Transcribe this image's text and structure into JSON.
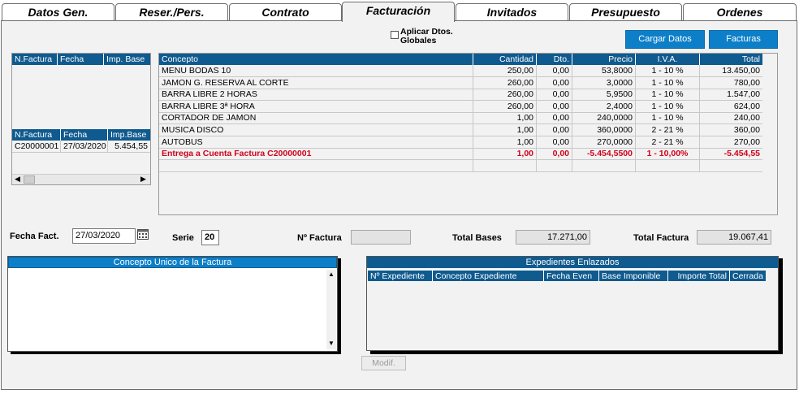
{
  "tabs": [
    "Datos Gen.",
    "Reser./Pers.",
    "Contrato",
    "Facturación",
    "Invitados",
    "Presupuesto",
    "Ordenes"
  ],
  "active_tab": "Facturación",
  "top": {
    "aplicar_label_1": "Aplicar Dtos.",
    "aplicar_label_2": "Globales",
    "cargar_datos": "Cargar Datos",
    "facturas": "Facturas"
  },
  "left_grid_1": {
    "headers": [
      "N.Factura",
      "Fecha",
      "Imp. Base"
    ]
  },
  "left_grid_2": {
    "headers": [
      "N.Factura",
      "Fecha",
      "Imp.Base"
    ],
    "rows": [
      [
        "C20000001",
        "27/03/2020",
        "5.454,55"
      ]
    ]
  },
  "lines": {
    "headers": [
      "Concepto",
      "Cantidad",
      "Dto.",
      "Precio",
      "I.V.A.",
      "Total"
    ],
    "rows": [
      [
        "MENU BODAS 10",
        "250,00",
        "0,00",
        "53,8000",
        "1 - 10 %",
        "13.450,00"
      ],
      [
        "JAMON G. RESERVA AL CORTE",
        "260,00",
        "0,00",
        "3,0000",
        "1 - 10 %",
        "780,00"
      ],
      [
        "BARRA LIBRE 2 HORAS",
        "260,00",
        "0,00",
        "5,9500",
        "1 - 10 %",
        "1.547,00"
      ],
      [
        "BARRA LIBRE 3ª HORA",
        "260,00",
        "0,00",
        "2,4000",
        "1 - 10 %",
        "624,00"
      ],
      [
        "CORTADOR DE JAMON",
        "1,00",
        "0,00",
        "240,0000",
        "1 - 10 %",
        "240,00"
      ],
      [
        "MUSICA DISCO",
        "1,00",
        "0,00",
        "360,0000",
        "2 - 21 %",
        "360,00"
      ],
      [
        "AUTOBUS",
        "1,00",
        "0,00",
        "270,0000",
        "2 - 21 %",
        "270,00"
      ]
    ],
    "highlight_row": [
      "Entrega a Cuenta Factura C20000001",
      "1,00",
      "0,00",
      "-5.454,5500",
      "1 - 10,00%",
      "-5.454,55"
    ]
  },
  "form": {
    "fecha_label": "Fecha Fact.",
    "fecha_value": "27/03/2020",
    "serie_label": "Serie",
    "serie_value": "20",
    "nfactura_label": "Nº Factura",
    "nfactura_value": "",
    "total_bases_label": "Total Bases",
    "total_bases_value": "17.271,00",
    "total_factura_label": "Total Factura",
    "total_factura_value": "19.067,41"
  },
  "concepto_unico": {
    "title": "Concepto Unico de la Factura"
  },
  "expedientes": {
    "title": "Expedientes Enlazados",
    "headers": [
      "Nº Expediente",
      "Concepto Expediente",
      "Fecha Even",
      "Base Imponible",
      "Importe Total",
      "Cerrada"
    ]
  },
  "modif": "Modif.",
  "colors": {
    "header_blue": "#0f5a8e",
    "button_blue": "#0d7fc9",
    "highlight_red": "#d0021b"
  }
}
